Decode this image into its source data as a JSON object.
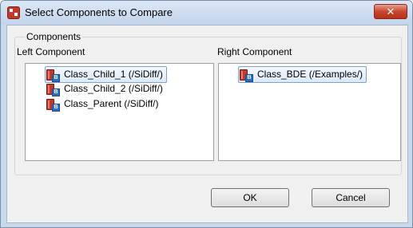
{
  "window": {
    "title": "Select Components to Compare",
    "close_label": "✕"
  },
  "group": {
    "legend": "Components"
  },
  "left": {
    "label": "Left Component",
    "items": [
      {
        "label": "Class_Child_1 (/SiDiff/)",
        "selected": true
      },
      {
        "label": "Class_Child_2 (/SiDiff/)",
        "selected": false
      },
      {
        "label": "Class_Parent (/SiDiff/)",
        "selected": false
      }
    ]
  },
  "right": {
    "label": "Right Component",
    "items": [
      {
        "label": "Class_BDE (/Examples/)",
        "selected": true
      }
    ]
  },
  "buttons": {
    "ok": "OK",
    "cancel": "Cancel"
  },
  "icons": {
    "app": "compare-app-icon",
    "item": "class-icon",
    "close": "close-icon"
  }
}
